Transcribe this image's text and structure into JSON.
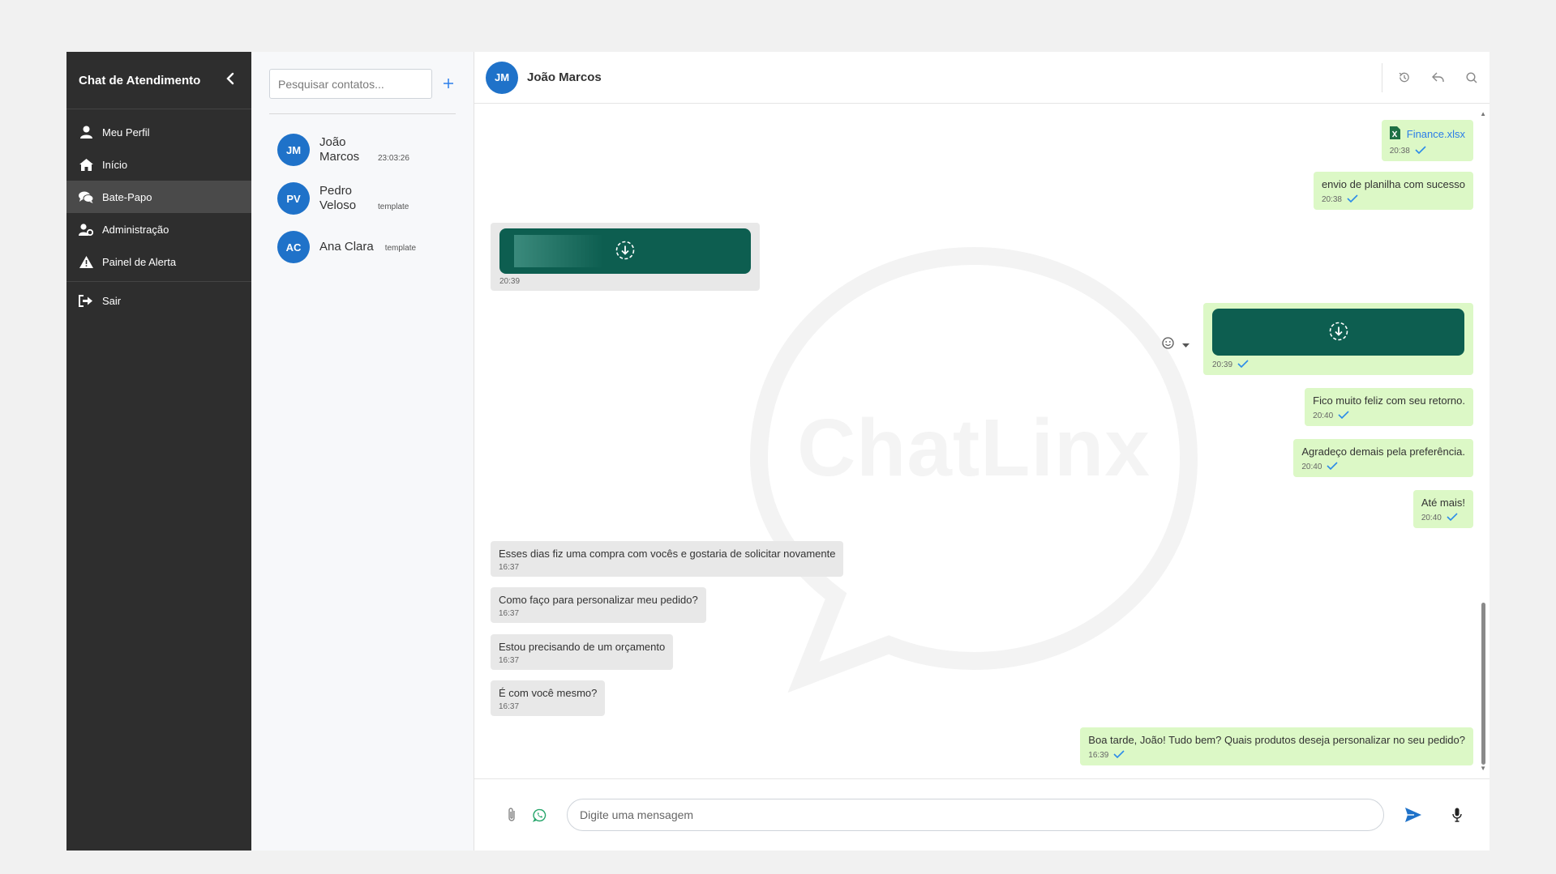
{
  "sidebar": {
    "title": "Chat de Atendimento",
    "items": [
      {
        "label": "Meu Perfil",
        "icon": "user-icon"
      },
      {
        "label": "Início",
        "icon": "home-icon"
      },
      {
        "label": "Bate-Papo",
        "icon": "chat-icon"
      },
      {
        "label": "Administração",
        "icon": "user-cog-icon"
      },
      {
        "label": "Painel de Alerta",
        "icon": "warning-icon"
      }
    ],
    "logout": "Sair"
  },
  "contacts": {
    "search_placeholder": "Pesquisar contatos...",
    "items": [
      {
        "initials": "JM",
        "name": "João Marcos",
        "meta": "23:03:26"
      },
      {
        "initials": "PV",
        "name": "Pedro Veloso",
        "meta": "template"
      },
      {
        "initials": "AC",
        "name": "Ana Clara",
        "meta": "template"
      }
    ]
  },
  "chat": {
    "initials": "JM",
    "name": "João Marcos",
    "watermark": "ChatLinx",
    "input_placeholder": "Digite uma mensagem",
    "messages": [
      {
        "dir": "out",
        "file": "Finance.xlsx",
        "time": "20:38"
      },
      {
        "dir": "out",
        "text": "envio de planilha com sucesso",
        "time": "20:38"
      },
      {
        "dir": "in",
        "media": true,
        "time": "20:39"
      },
      {
        "dir": "out",
        "media": true,
        "time": "20:39"
      },
      {
        "dir": "out",
        "text": "Fico muito feliz com seu retorno.",
        "time": "20:40"
      },
      {
        "dir": "out",
        "text": "Agradeço demais pela preferência.",
        "time": "20:40"
      },
      {
        "dir": "out",
        "text": "Até mais!",
        "time": "20:40"
      },
      {
        "dir": "in",
        "text": "Esses dias fiz uma compra com vocês e gostaria de solicitar novamente",
        "time": "16:37"
      },
      {
        "dir": "in",
        "text": "Como faço para personalizar meu pedido?",
        "time": "16:37"
      },
      {
        "dir": "in",
        "text": "Estou precisando de um orçamento",
        "time": "16:37"
      },
      {
        "dir": "in",
        "text": "É com você mesmo?",
        "time": "16:37"
      },
      {
        "dir": "out",
        "text": "Boa tarde, João! Tudo bem? Quais produtos deseja personalizar no seu pedido?",
        "time": "16:39"
      }
    ]
  },
  "colors": {
    "sidebar_bg": "#2e2e2e",
    "accent": "#1f72c9",
    "outgoing_bubble": "#dcf8c6",
    "incoming_bubble": "#e8e8e8",
    "media_bg": "#0d5e50"
  }
}
